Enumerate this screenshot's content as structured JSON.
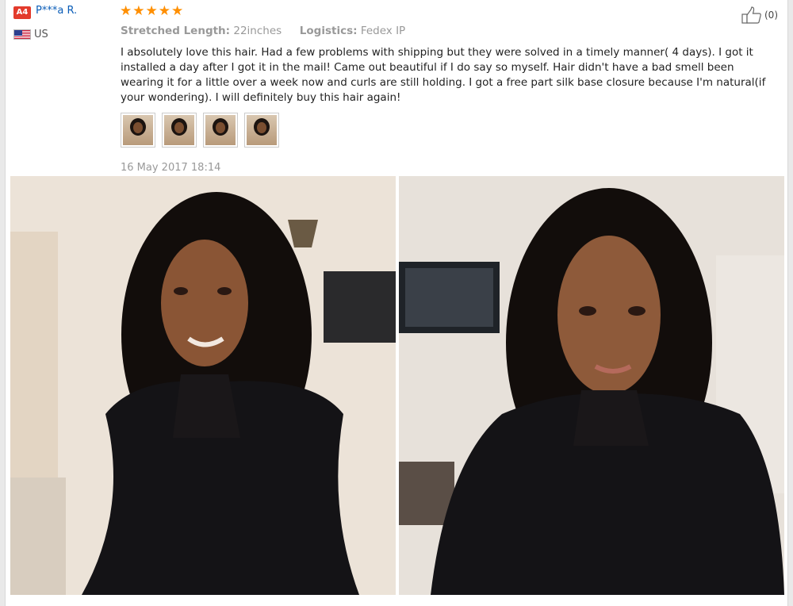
{
  "reviewer": {
    "badge": "A4",
    "name": "P***a R.",
    "country": "US",
    "flag_icon": "us-flag-icon"
  },
  "rating": {
    "stars": 5,
    "max": 5,
    "star_color": "#ff8f00"
  },
  "attributes": {
    "length_label": "Stretched Length:",
    "length_value": "22inches",
    "logistics_label": "Logistics:",
    "logistics_value": "Fedex IP"
  },
  "helpful": {
    "icon": "thumbs-up-icon",
    "count": "(0)"
  },
  "review_text": "I absolutely love this hair. Had a few problems with shipping but they were solved in a timely manner( 4 days). I got it installed a day after I got it in the mail! Came out beautiful if I do say so myself. Hair didn't have a bad smell been wearing it for a little over a week now and curls are still holding. I got a free part silk base closure because I'm natural(if your wondering). I will definitely buy this hair again!",
  "thumbnails_count": 4,
  "date": "16 May 2017 18:14",
  "colors": {
    "username": "#0a5db8",
    "badge": "#e33b2c"
  }
}
